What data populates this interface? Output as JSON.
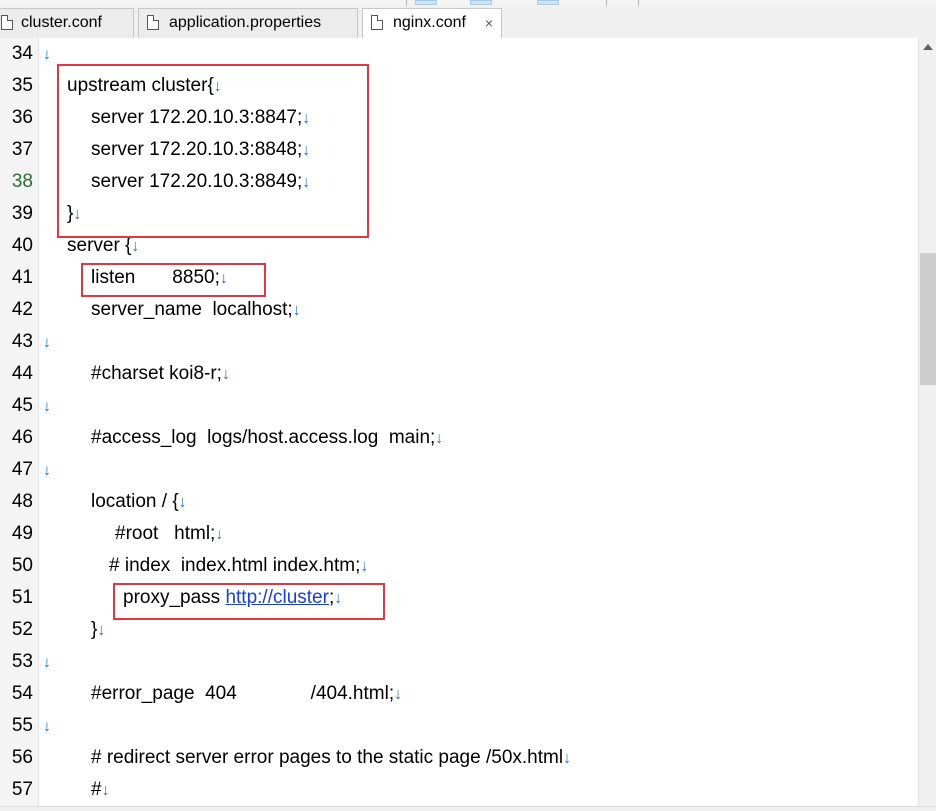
{
  "tabs": [
    {
      "label": "cluster.conf",
      "active": false,
      "closable": false
    },
    {
      "label": "application.properties",
      "active": false,
      "closable": false
    },
    {
      "label": "nginx.conf",
      "active": true,
      "closable": true
    }
  ],
  "tab_close_glyph": "×",
  "eol_glyph": "↓",
  "current_line": "38",
  "lines": [
    {
      "num": "34",
      "text": ""
    },
    {
      "num": "35",
      "text": "upstream cluster{"
    },
    {
      "num": "36",
      "text": "server 172.20.10.3:8847;"
    },
    {
      "num": "37",
      "text": "server 172.20.10.3:8848;"
    },
    {
      "num": "38",
      "text": "server 172.20.10.3:8849;"
    },
    {
      "num": "39",
      "text": "}"
    },
    {
      "num": "40",
      "text": "server {"
    },
    {
      "num": "41",
      "text": "listen       8850;"
    },
    {
      "num": "42",
      "text": "server_name  localhost;"
    },
    {
      "num": "43",
      "text": ""
    },
    {
      "num": "44",
      "text": "#charset koi8-r;"
    },
    {
      "num": "45",
      "text": ""
    },
    {
      "num": "46",
      "text": "#access_log  logs/host.access.log  main;"
    },
    {
      "num": "47",
      "text": ""
    },
    {
      "num": "48",
      "text": "location / {"
    },
    {
      "num": "49",
      "text": "#root   html;"
    },
    {
      "num": "50",
      "text": "# index  index.html index.htm;"
    },
    {
      "num": "51",
      "text": "proxy_pass ",
      "link": "http://cluster",
      "after": ";"
    },
    {
      "num": "52",
      "text": "}"
    },
    {
      "num": "53",
      "text": ""
    },
    {
      "num": "54",
      "text": "#error_page  404              /404.html;"
    },
    {
      "num": "55",
      "text": ""
    },
    {
      "num": "56",
      "text": "# redirect server error pages to the static page /50x.html"
    },
    {
      "num": "57",
      "text": "#"
    }
  ],
  "colors": {
    "highlight_box": "#e2373f",
    "eol_marker": "#2a74c9",
    "link": "#1a3fd6",
    "current_line_number": "#2e6b3d"
  }
}
